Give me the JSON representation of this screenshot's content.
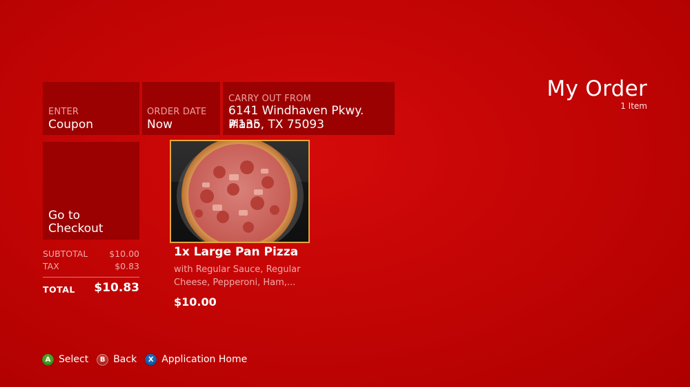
{
  "header": {
    "title": "My Order",
    "item_count": "1 Item"
  },
  "tiles": {
    "coupon": {
      "small": "ENTER",
      "main": "Coupon"
    },
    "order_date": {
      "small": "ORDER DATE",
      "main": "Now"
    },
    "carry_out": {
      "small": "CARRY OUT FROM",
      "address_line1": "6141 Windhaven Pkwy. #135",
      "address_line2": "Plano, TX  75093"
    },
    "checkout": {
      "main": "Go to Checkout"
    }
  },
  "totals": {
    "subtotal_label": "SUBTOTAL",
    "subtotal_value": "$10.00",
    "tax_label": "TAX",
    "tax_value": "$0.83",
    "total_label": "TOTAL",
    "total_value": "$10.83"
  },
  "order_item": {
    "name": "1x Large Pan Pizza",
    "description": "with Regular Sauce, Regular Cheese, Pepperoni, Ham,...",
    "price": "$10.00",
    "image_icon": "pizza-image"
  },
  "footer": {
    "buttons": [
      {
        "badge": "A",
        "label": "Select",
        "color": "#4fa326"
      },
      {
        "badge": "B",
        "label": "Back",
        "color": "#c8362f"
      },
      {
        "badge": "X",
        "label": "Application Home",
        "color": "#1f66b8"
      }
    ]
  },
  "colors": {
    "background": "#c40606",
    "tile": "#9b0101",
    "selection_border": "#e8a83a"
  }
}
